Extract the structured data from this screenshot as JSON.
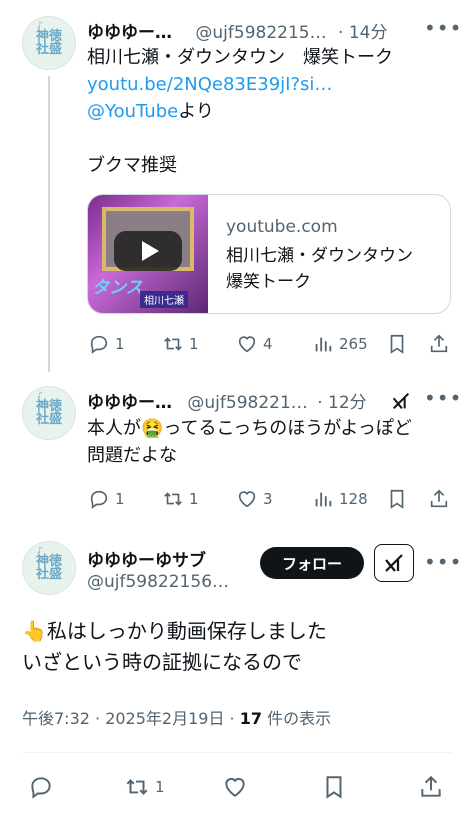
{
  "tweets": [
    {
      "name": "ゆゆゆー…",
      "handle": "@ujf5982215…",
      "time": "· 14分",
      "more": "•••",
      "line1": "相川七瀬・ダウンタウン　爆笑トーク",
      "link": "youtu.be/2NQe83E39jI?si…",
      "yt_link": "@YouTube",
      "yori": "より",
      "line4": "ブクマ推奨",
      "card": {
        "domain": "youtube.com",
        "title": "相川七瀬・ダウンタウン　爆笑トーク",
        "thumb_left": "タンス",
        "thumb_right": "相川七瀬"
      },
      "replies": "1",
      "reposts": "1",
      "likes": "4",
      "views": "265"
    },
    {
      "name": "ゆゆゆー…",
      "handle": "@ujf598221…",
      "time": "· 12分",
      "more": "•••",
      "line1a": "本人が",
      "emoji": "🤮",
      "line1b": "ってるこっちのほうがよっぽど",
      "line2": "問題だよな",
      "replies": "1",
      "reposts": "1",
      "likes": "3",
      "views": "128"
    }
  ],
  "main": {
    "name": "ゆゆゆーゆサブ",
    "handle": "@ujf59822156…",
    "follow_label": "フォロー",
    "more": "•••",
    "emoji": "👆",
    "line1": "私はしっかり動画保存しました",
    "line2": "いざという時の証拠になるので",
    "timestamp": "午後7:32 · 2025年2月19日 · ",
    "views_count": "17",
    "views_label": " 件の表示",
    "reposts": "1"
  },
  "avatar": {
    "top": "♪",
    "text": "神徳社盛"
  }
}
